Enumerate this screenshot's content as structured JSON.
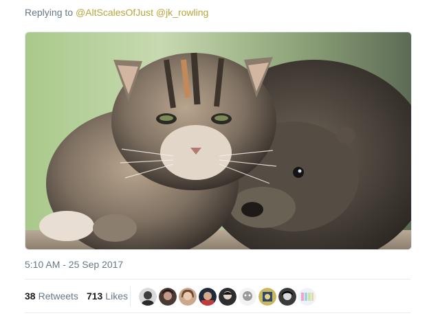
{
  "reply": {
    "prefix": "Replying to",
    "mentions": [
      "@AltScalesOfJust",
      "@jk_rowling"
    ]
  },
  "media": {
    "alt": "Tabby kitten and baby otter"
  },
  "timestamp": "5:10 AM - 25 Sep 2017",
  "stats": {
    "retweets_count": "38",
    "retweets_label": "Retweets",
    "likes_count": "713",
    "likes_label": "Likes"
  },
  "liked_by_avatars": [
    {
      "name": "avatar-1"
    },
    {
      "name": "avatar-2"
    },
    {
      "name": "avatar-3"
    },
    {
      "name": "avatar-4"
    },
    {
      "name": "avatar-5"
    },
    {
      "name": "avatar-6"
    },
    {
      "name": "avatar-7"
    },
    {
      "name": "avatar-8"
    },
    {
      "name": "avatar-9"
    }
  ],
  "colors": {
    "mention": "#b8a53c",
    "muted_text": "#657786",
    "primary_text": "#14171a",
    "divider": "#e6ecf0"
  }
}
